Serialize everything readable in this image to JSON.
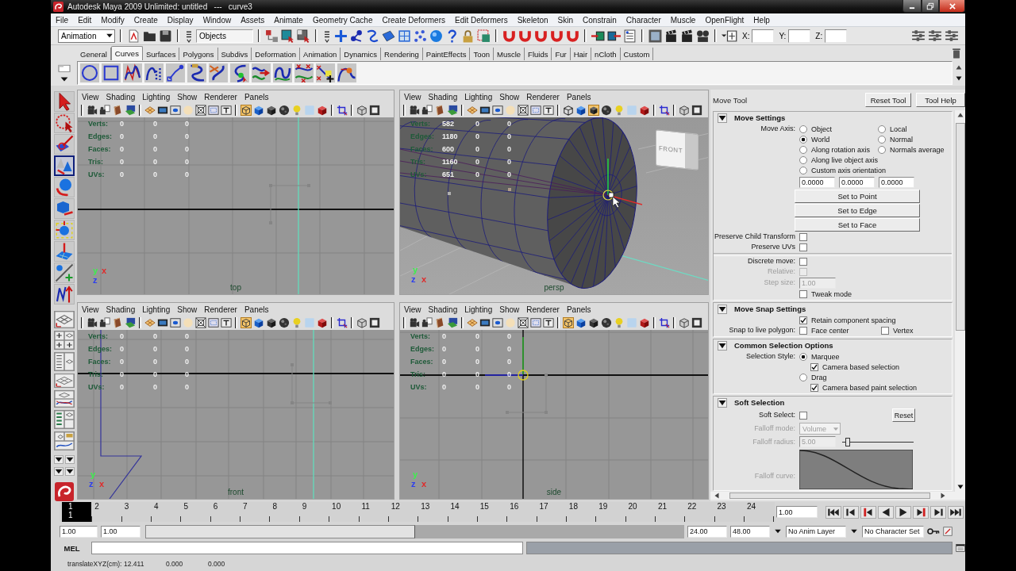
{
  "window": {
    "title": "Autodesk Maya 2009 Unlimited: untitled   ---   curve3"
  },
  "menu_bar": [
    "File",
    "Edit",
    "Modify",
    "Create",
    "Display",
    "Window",
    "Assets",
    "Animate",
    "Geometry Cache",
    "Create Deformers",
    "Edit Deformers",
    "Skeleton",
    "Skin",
    "Constrain",
    "Character",
    "Muscle",
    "OpenFlight",
    "Help"
  ],
  "status_line": {
    "menu_set": "Animation",
    "selection_mode": "Objects",
    "coordinate_fields": [
      "X:",
      "Y:",
      "Z:"
    ]
  },
  "shelf_tabs": [
    {
      "label": "General",
      "selected": false
    },
    {
      "label": "Curves",
      "selected": true
    },
    {
      "label": "Surfaces",
      "selected": false
    },
    {
      "label": "Polygons",
      "selected": false
    },
    {
      "label": "Subdivs",
      "selected": false
    },
    {
      "label": "Deformation",
      "selected": false
    },
    {
      "label": "Animation",
      "selected": false
    },
    {
      "label": "Dynamics",
      "selected": false
    },
    {
      "label": "Rendering",
      "selected": false
    },
    {
      "label": "PaintEffects",
      "selected": false
    },
    {
      "label": "Toon",
      "selected": false
    },
    {
      "label": "Muscle",
      "selected": false
    },
    {
      "label": "Fluids",
      "selected": false
    },
    {
      "label": "Fur",
      "selected": false
    },
    {
      "label": "Hair",
      "selected": false
    },
    {
      "label": "nCloth",
      "selected": false
    },
    {
      "label": "Custom",
      "selected": false
    }
  ],
  "toolbox": [
    {
      "kind": "select",
      "selected": false
    },
    {
      "kind": "lasso",
      "selected": false
    },
    {
      "kind": "paint_select",
      "selected": false
    },
    {
      "kind": "move",
      "selected": true
    },
    {
      "kind": "rotate",
      "selected": false
    },
    {
      "kind": "scale",
      "selected": false
    },
    {
      "kind": "universal_manip",
      "selected": false
    },
    {
      "kind": "soft_mod",
      "selected": false
    },
    {
      "kind": "show_manip",
      "selected": false
    },
    {
      "kind": "curve_tool",
      "selected": false
    }
  ],
  "viewports": [
    {
      "kind": "top",
      "menu": [
        "View",
        "Shading",
        "Lighting",
        "Show",
        "Renderer",
        "Panels"
      ],
      "shading_modes": [
        {
          "kind": "wireframe",
          "selected": true
        },
        {
          "kind": "smooth",
          "selected": false
        },
        {
          "kind": "wireframe_on_shaded",
          "selected": false
        }
      ],
      "hud": [
        {
          "label": "Verts:",
          "values": [
            "0",
            "0",
            "0"
          ]
        },
        {
          "label": "Edges:",
          "values": [
            "0",
            "0",
            "0"
          ]
        },
        {
          "label": "Faces:",
          "values": [
            "0",
            "0",
            "0"
          ]
        },
        {
          "label": "Tris:",
          "values": [
            "0",
            "0",
            "0"
          ]
        },
        {
          "label": "UVs:",
          "values": [
            "0",
            "0",
            "0"
          ]
        }
      ],
      "camera_label": "top",
      "axes": [
        {
          "label": "y",
          "color": "#3cf04c"
        },
        {
          "label": "x",
          "color": "#e02a2a"
        },
        {
          "label": "z",
          "color": "#2a3cf0"
        }
      ]
    },
    {
      "kind": "persp",
      "menu": [
        "View",
        "Shading",
        "Lighting",
        "Show",
        "Renderer",
        "Panels"
      ],
      "shading_modes": [
        {
          "kind": "wireframe",
          "selected": false
        },
        {
          "kind": "smooth",
          "selected": false
        },
        {
          "kind": "wireframe_on_shaded",
          "selected": true
        }
      ],
      "hud": [
        {
          "label": "Verts:",
          "values": [
            "582",
            "0",
            "0"
          ]
        },
        {
          "label": "Edges:",
          "values": [
            "1180",
            "0",
            "0"
          ]
        },
        {
          "label": "Faces:",
          "values": [
            "600",
            "0",
            "0"
          ]
        },
        {
          "label": "Tris:",
          "values": [
            "1160",
            "0",
            "0"
          ]
        },
        {
          "label": "UVs:",
          "values": [
            "651",
            "0",
            "0"
          ]
        }
      ],
      "camera_label": "persp",
      "view_cube": "FRONT",
      "axes": [
        {
          "label": "y",
          "color": "#3cf04c"
        },
        {
          "label": "x",
          "color": "#e02a2a"
        },
        {
          "label": "z",
          "color": "#2a3cf0"
        }
      ]
    },
    {
      "kind": "front",
      "menu": [
        "View",
        "Shading",
        "Lighting",
        "Show",
        "Renderer",
        "Panels"
      ],
      "shading_modes": [
        {
          "kind": "wireframe",
          "selected": true
        },
        {
          "kind": "smooth",
          "selected": false
        },
        {
          "kind": "wireframe_on_shaded",
          "selected": false
        }
      ],
      "hud": [
        {
          "label": "Verts:",
          "values": [
            "0",
            "0",
            "0"
          ]
        },
        {
          "label": "Edges:",
          "values": [
            "0",
            "0",
            "0"
          ]
        },
        {
          "label": "Faces:",
          "values": [
            "0",
            "0",
            "0"
          ]
        },
        {
          "label": "Tris:",
          "values": [
            "0",
            "0",
            "0"
          ]
        },
        {
          "label": "UVs:",
          "values": [
            "0",
            "0",
            "0"
          ]
        }
      ],
      "camera_label": "front",
      "axes": [
        {
          "label": "y",
          "color": "#3cf04c"
        },
        {
          "label": "x",
          "color": "#e02a2a"
        },
        {
          "label": "z",
          "color": "#2a3cf0"
        }
      ]
    },
    {
      "kind": "side",
      "menu": [
        "View",
        "Shading",
        "Lighting",
        "Show",
        "Renderer",
        "Panels"
      ],
      "shading_modes": [
        {
          "kind": "wireframe",
          "selected": true
        },
        {
          "kind": "smooth",
          "selected": false
        },
        {
          "kind": "wireframe_on_shaded",
          "selected": false
        }
      ],
      "hud": [
        {
          "label": "Verts:",
          "values": [
            "0",
            "0",
            "0"
          ]
        },
        {
          "label": "Edges:",
          "values": [
            "0",
            "0",
            "0"
          ]
        },
        {
          "label": "Faces:",
          "values": [
            "0",
            "0",
            "0"
          ]
        },
        {
          "label": "Tris:",
          "values": [
            "0",
            "0",
            "0"
          ]
        },
        {
          "label": "UVs:",
          "values": [
            "0",
            "0",
            "0"
          ]
        }
      ],
      "camera_label": "side",
      "axes": [
        {
          "label": "y",
          "color": "#3cf04c"
        },
        {
          "label": "x",
          "color": "#e02a2a"
        },
        {
          "label": "z",
          "color": "#2a3cf0"
        }
      ]
    }
  ],
  "tool_settings": {
    "title": "Move Tool",
    "buttons": [
      "Reset Tool",
      "Tool Help"
    ],
    "sections": [
      {
        "title": "Move Settings",
        "expanded": true,
        "rows": [
          {
            "kind": "radio_group",
            "label": "Move Axis:",
            "columns": [
              [
                {
                  "label": "Object",
                  "selected": false
                },
                {
                  "label": "World",
                  "selected": true
                },
                {
                  "label": "Along rotation axis",
                  "selected": false
                },
                {
                  "label": "Along live object axis",
                  "selected": false
                },
                {
                  "label": "Custom axis orientation",
                  "selected": false
                }
              ],
              [
                {
                  "label": "Local",
                  "selected": false
                },
                {
                  "label": "Normal",
                  "selected": false
                },
                {
                  "label": "Normals average",
                  "selected": false
                }
              ]
            ]
          },
          {
            "kind": "fields",
            "values": [
              "0.0000",
              "0.0000",
              "0.0000"
            ]
          },
          {
            "kind": "button",
            "label": "Set to Point"
          },
          {
            "kind": "button",
            "label": "Set to Edge"
          },
          {
            "kind": "button",
            "label": "Set to Face"
          },
          {
            "kind": "checkbox",
            "label": "Preserve Child Transform",
            "checked": false,
            "disabled": false
          },
          {
            "kind": "checkbox",
            "label": "Preserve UVs",
            "checked": false,
            "disabled": false
          },
          {
            "kind": "separator"
          },
          {
            "kind": "checkbox",
            "label": "Discrete move:",
            "checked": false,
            "disabled": false
          },
          {
            "kind": "checkbox",
            "label": "Relative:",
            "checked": false,
            "disabled": true
          },
          {
            "kind": "field",
            "label": "Step size:",
            "value": "1.00",
            "disabled": true
          },
          {
            "kind": "option",
            "label": "Tweak mode",
            "checked": false
          }
        ]
      },
      {
        "title": "Move Snap Settings",
        "expanded": true,
        "rows": [
          {
            "kind": "option",
            "label": "Retain component spacing",
            "checked": true
          },
          {
            "kind": "check_pair",
            "label": "Snap to live polygon:",
            "options": [
              {
                "label": "Face center",
                "checked": false
              },
              {
                "label": "Vertex",
                "checked": false
              }
            ]
          }
        ]
      },
      {
        "title": "Common Selection Options",
        "expanded": true,
        "rows": [
          {
            "kind": "radio_group",
            "label": "Selection Style:",
            "columns": [
              [
                {
                  "label": "Marquee",
                  "selected": true,
                  "option": {
                    "label": "Camera based selection",
                    "checked": true
                  }
                },
                {
                  "label": "Drag",
                  "selected": false,
                  "option": {
                    "label": "Camera based paint selection",
                    "checked": true
                  }
                }
              ]
            ]
          }
        ]
      },
      {
        "title": "Soft Selection",
        "expanded": true,
        "rows": [
          {
            "kind": "checkbox",
            "label": "Soft Select:",
            "checked": false,
            "disabled": false,
            "button": "Reset"
          },
          {
            "kind": "dropdown",
            "label": "Falloff mode:",
            "value": "Volume",
            "disabled": true
          },
          {
            "kind": "slider",
            "label": "Falloff radius:",
            "value": "5.00",
            "level": 0.05,
            "disabled": true
          },
          {
            "kind": "curve",
            "label": "Falloff curve:",
            "disabled": true
          }
        ]
      }
    ]
  },
  "time_slider": {
    "frames": [
      {
        "label": "1",
        "selected": true
      },
      {
        "label": "2",
        "selected": false
      },
      {
        "label": "3",
        "selected": false
      },
      {
        "label": "4",
        "selected": false
      },
      {
        "label": "5",
        "selected": false
      },
      {
        "label": "6",
        "selected": false
      },
      {
        "label": "7",
        "selected": false
      },
      {
        "label": "8",
        "selected": false
      },
      {
        "label": "9",
        "selected": false
      },
      {
        "label": "10",
        "selected": false
      },
      {
        "label": "11",
        "selected": false
      },
      {
        "label": "12",
        "selected": false
      },
      {
        "label": "13",
        "selected": false
      },
      {
        "label": "14",
        "selected": false
      },
      {
        "label": "15",
        "selected": false
      },
      {
        "label": "16",
        "selected": false
      },
      {
        "label": "17",
        "selected": false
      },
      {
        "label": "18",
        "selected": false
      },
      {
        "label": "19",
        "selected": false
      },
      {
        "label": "20",
        "selected": false
      },
      {
        "label": "21",
        "selected": false
      },
      {
        "label": "22",
        "selected": false
      },
      {
        "label": "23",
        "selected": false
      },
      {
        "label": "24",
        "selected": false
      }
    ],
    "current_frame": "1",
    "current_time": "1.00"
  },
  "range_slider": {
    "start": "1.00",
    "range_start": "1.00",
    "level": 0.5,
    "range_end": "24.00",
    "end": "48.00",
    "anim_layer": "No Anim Layer",
    "character_set": "No Character Set"
  },
  "command_line": {
    "language": "MEL"
  },
  "help_line": {
    "label": "translateXYZ(cm):",
    "values": [
      "12.411",
      "0.000",
      "0.000"
    ]
  }
}
